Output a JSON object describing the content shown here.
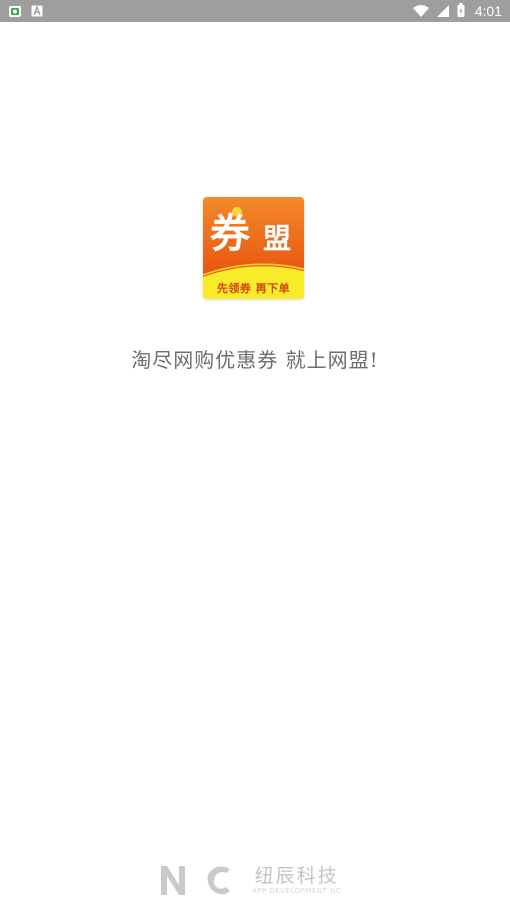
{
  "status_bar": {
    "time": "4:01",
    "left_icons": [
      "app-notification-icon",
      "font-app-icon"
    ],
    "right_icons": [
      "wifi-icon",
      "cell-signal-icon",
      "battery-icon"
    ],
    "background": "#9e9e9e"
  },
  "logo": {
    "main_char": "券",
    "secondary_char": "盟",
    "slogan": "先领券 再下单",
    "colors": {
      "primary": "#ea5a12",
      "accent": "#f8ec2a",
      "dot": "#ffd43a"
    }
  },
  "tagline": "淘尽网购优惠券 就上网盟!",
  "footer": {
    "brand_cn": "纽辰科技",
    "brand_en": "APP DEVELOPMENT NC"
  }
}
